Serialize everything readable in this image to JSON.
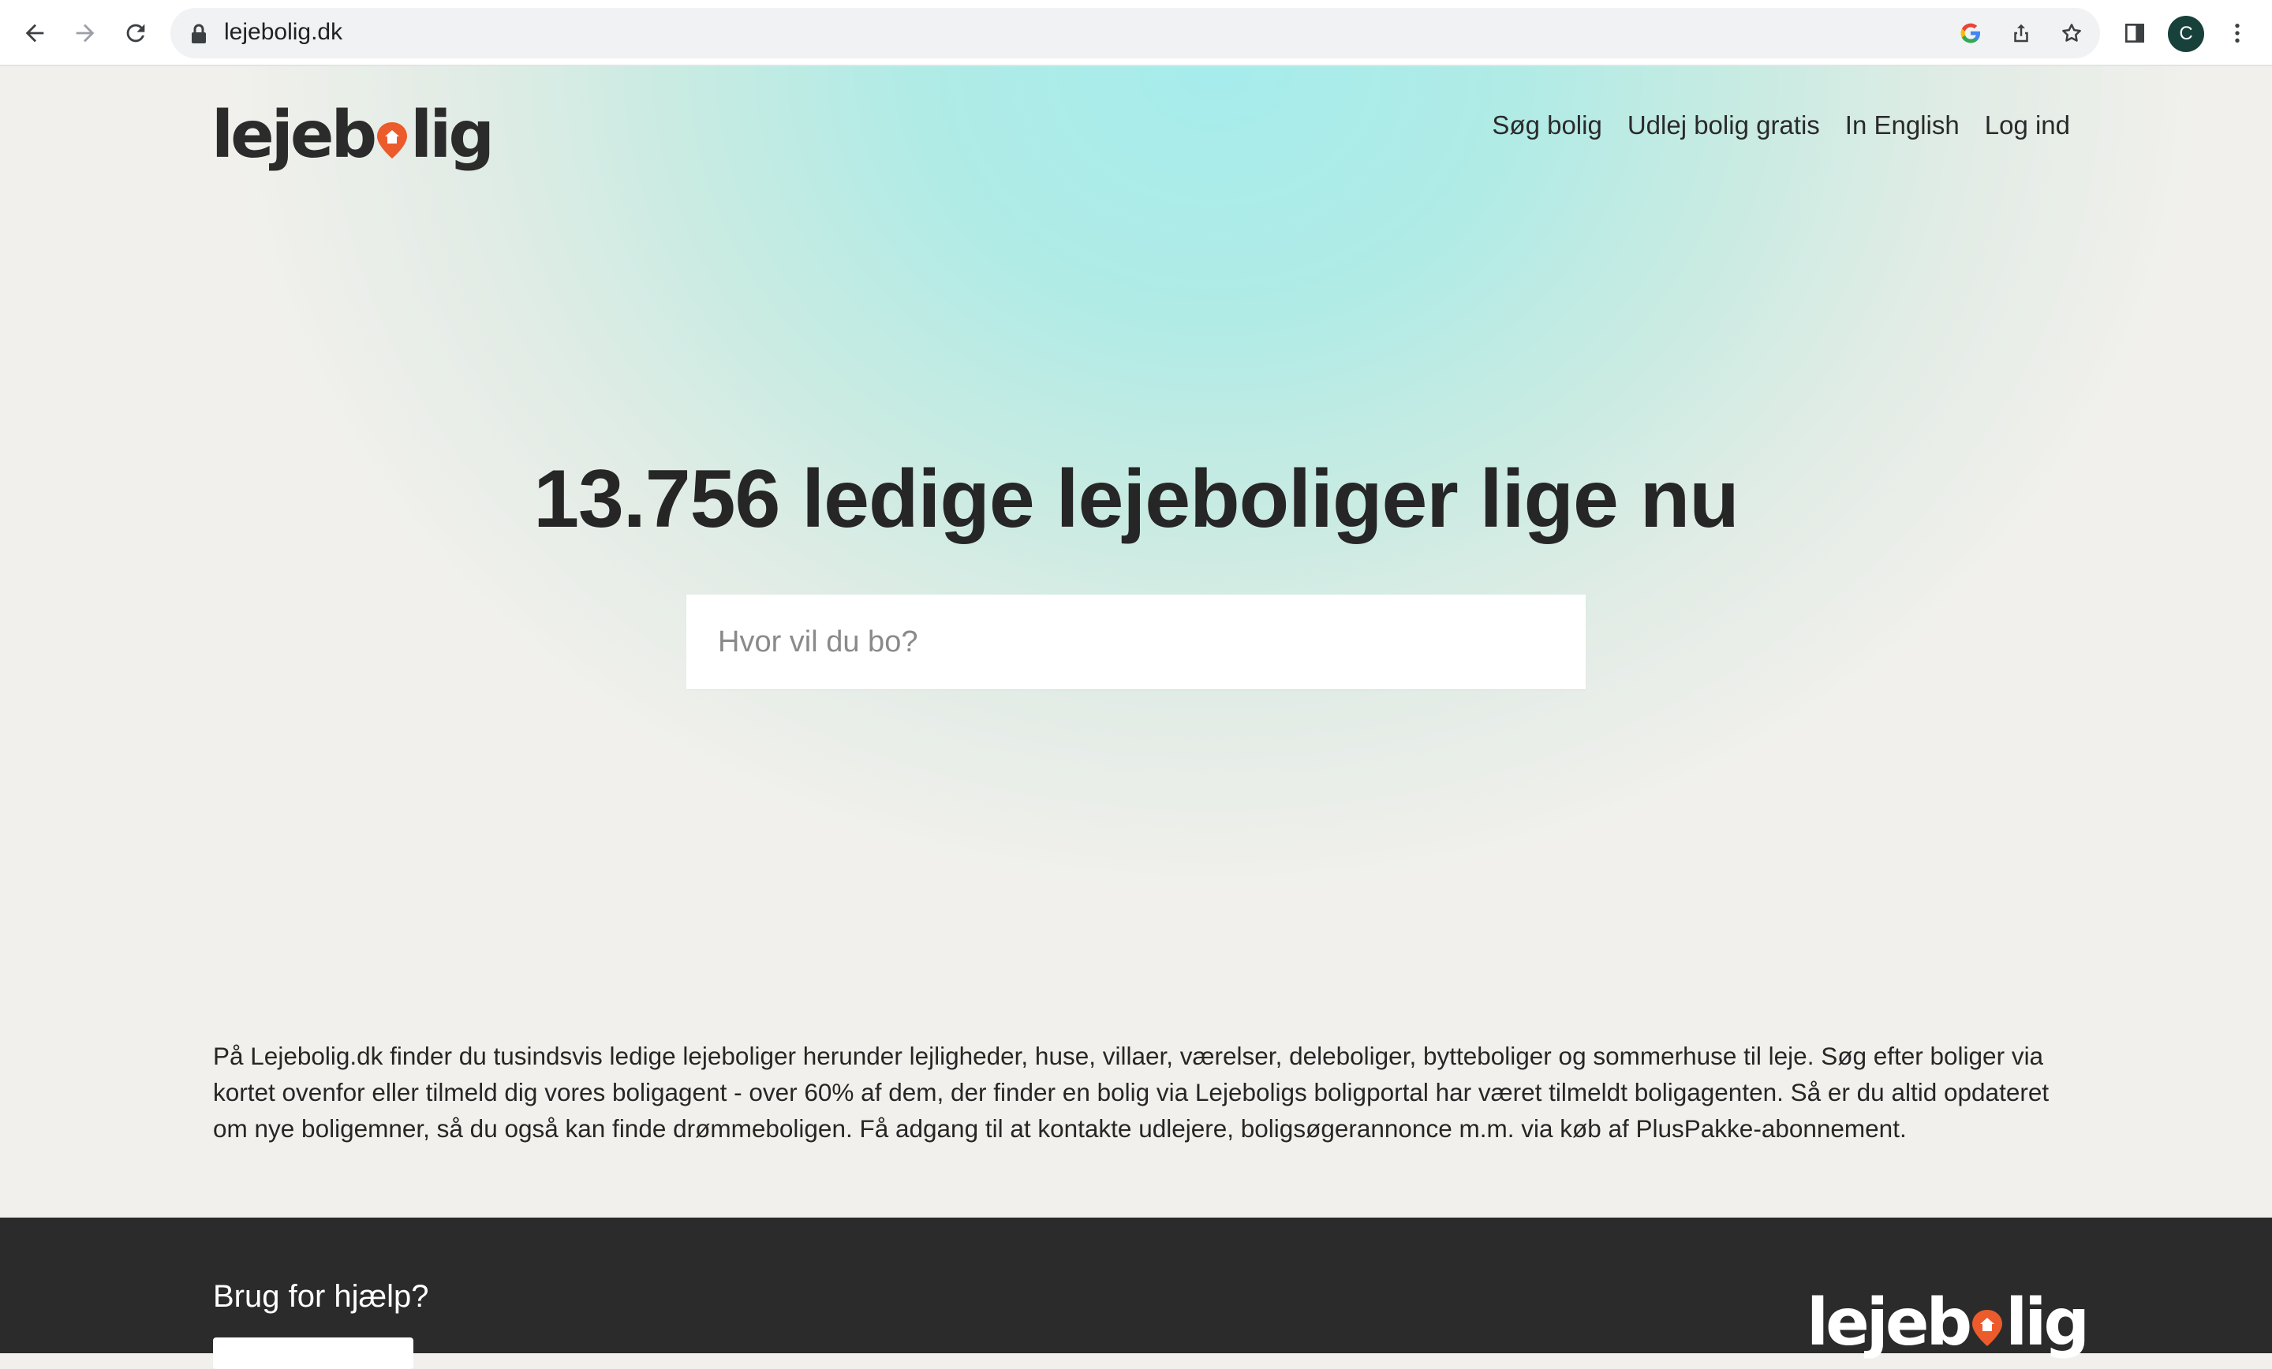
{
  "browser": {
    "url": "lejebolig.dk",
    "profile_initial": "C",
    "icons": [
      "back-arrow-icon",
      "forward-arrow-icon",
      "reload-icon",
      "lock-icon",
      "google-icon",
      "share-icon",
      "star-icon",
      "side-panel-icon",
      "more-vert-icon"
    ]
  },
  "header": {
    "logo_prefix": "lejeb",
    "logo_suffix": "lig",
    "nav": [
      {
        "label": "Søg bolig"
      },
      {
        "label": "Udlej bolig gratis"
      },
      {
        "label": "In English"
      },
      {
        "label": "Log ind"
      }
    ]
  },
  "hero": {
    "title": "13.756 ledige lejeboliger lige nu",
    "search_placeholder": "Hvor vil du bo?"
  },
  "intro": {
    "text": "På Lejebolig.dk finder du tusindsvis ledige lejeboliger herunder lejligheder, huse, villaer, værelser, deleboliger, bytteboliger og sommerhuse til leje. Søg efter boliger via kortet ovenfor eller tilmeld dig vores boligagent - over 60% af dem, der finder en bolig via Lejeboligs boligportal har været tilmeldt boligagenten. Så er du altid opdateret om nye boligemner, så du også kan finde drømmeboligen. Få adgang til at kontakte udlejere, boligsøgerannonce m.m. via køb af PlusPakke-abonnement."
  },
  "footer": {
    "help_title": "Brug for hjælp?",
    "logo_prefix": "lejeb",
    "logo_suffix": "lig"
  },
  "colors": {
    "brand_orange": "#ec5b2c",
    "hero_teal": "#a6ecec",
    "footer_bg": "#2b2b2b",
    "avatar_bg": "#17413a"
  }
}
